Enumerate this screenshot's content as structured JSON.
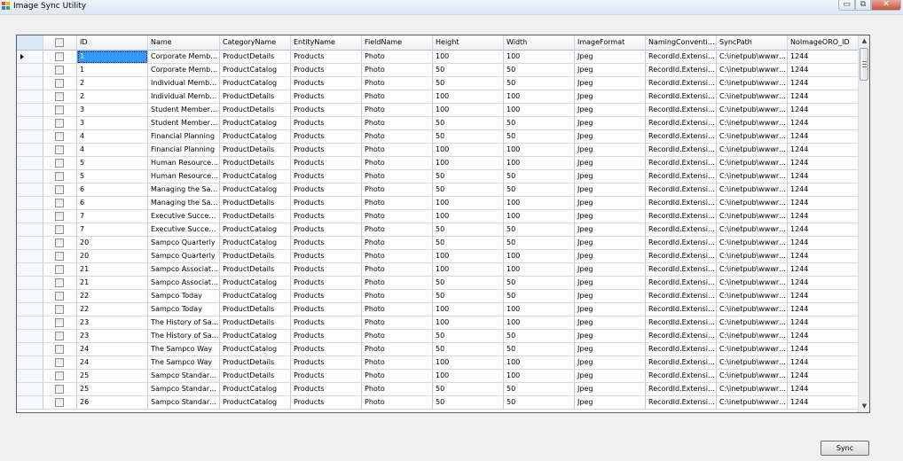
{
  "window": {
    "title": "Image Sync Utility",
    "minimize_glyph": "▭",
    "maximize_glyph": "⧉",
    "close_glyph": "✕"
  },
  "grid": {
    "columns": [
      "ID",
      "Name",
      "CategoryName",
      "EntityName",
      "FieldName",
      "Height",
      "Width",
      "ImageFormat",
      "NamingConvention",
      "SyncPath",
      "NoImageORO_ID"
    ],
    "rows": [
      {
        "id": "1",
        "name": "Corporate Member...",
        "category": "ProductDetails",
        "entity": "Products",
        "field": "Photo",
        "height": "100",
        "width": "100",
        "format": "Jpeg",
        "naming": "RecordId.Extension",
        "sync_path": "C:\\inetpub\\wwwro...",
        "no_image_id": "1244"
      },
      {
        "id": "1",
        "name": "Corporate Member...",
        "category": "ProductCatalog",
        "entity": "Products",
        "field": "Photo",
        "height": "50",
        "width": "50",
        "format": "Jpeg",
        "naming": "RecordId.Extension",
        "sync_path": "C:\\inetpub\\wwwro...",
        "no_image_id": "1244"
      },
      {
        "id": "2",
        "name": "Individual Member...",
        "category": "ProductCatalog",
        "entity": "Products",
        "field": "Photo",
        "height": "50",
        "width": "50",
        "format": "Jpeg",
        "naming": "RecordId.Extension",
        "sync_path": "C:\\inetpub\\wwwro...",
        "no_image_id": "1244"
      },
      {
        "id": "2",
        "name": "Individual Member...",
        "category": "ProductDetails",
        "entity": "Products",
        "field": "Photo",
        "height": "100",
        "width": "100",
        "format": "Jpeg",
        "naming": "RecordId.Extension",
        "sync_path": "C:\\inetpub\\wwwro...",
        "no_image_id": "1244"
      },
      {
        "id": "3",
        "name": "Student Membership",
        "category": "ProductDetails",
        "entity": "Products",
        "field": "Photo",
        "height": "100",
        "width": "100",
        "format": "Jpeg",
        "naming": "RecordId.Extension",
        "sync_path": "C:\\inetpub\\wwwro...",
        "no_image_id": "1244"
      },
      {
        "id": "3",
        "name": "Student Membership",
        "category": "ProductCatalog",
        "entity": "Products",
        "field": "Photo",
        "height": "50",
        "width": "50",
        "format": "Jpeg",
        "naming": "RecordId.Extension",
        "sync_path": "C:\\inetpub\\wwwro...",
        "no_image_id": "1244"
      },
      {
        "id": "4",
        "name": "Financial Planning",
        "category": "ProductCatalog",
        "entity": "Products",
        "field": "Photo",
        "height": "50",
        "width": "50",
        "format": "Jpeg",
        "naming": "RecordId.Extension",
        "sync_path": "C:\\inetpub\\wwwro...",
        "no_image_id": "1244"
      },
      {
        "id": "4",
        "name": "Financial Planning",
        "category": "ProductDetails",
        "entity": "Products",
        "field": "Photo",
        "height": "100",
        "width": "100",
        "format": "Jpeg",
        "naming": "RecordId.Extension",
        "sync_path": "C:\\inetpub\\wwwro...",
        "no_image_id": "1244"
      },
      {
        "id": "5",
        "name": "Human Resources...",
        "category": "ProductDetails",
        "entity": "Products",
        "field": "Photo",
        "height": "100",
        "width": "100",
        "format": "Jpeg",
        "naming": "RecordId.Extension",
        "sync_path": "C:\\inetpub\\wwwro...",
        "no_image_id": "1244"
      },
      {
        "id": "5",
        "name": "Human Resources...",
        "category": "ProductCatalog",
        "entity": "Products",
        "field": "Photo",
        "height": "50",
        "width": "50",
        "format": "Jpeg",
        "naming": "RecordId.Extension",
        "sync_path": "C:\\inetpub\\wwwro...",
        "no_image_id": "1244"
      },
      {
        "id": "6",
        "name": "Managing the Sam...",
        "category": "ProductCatalog",
        "entity": "Products",
        "field": "Photo",
        "height": "50",
        "width": "50",
        "format": "Jpeg",
        "naming": "RecordId.Extension",
        "sync_path": "C:\\inetpub\\wwwro...",
        "no_image_id": "1244"
      },
      {
        "id": "6",
        "name": "Managing the Sam...",
        "category": "ProductDetails",
        "entity": "Products",
        "field": "Photo",
        "height": "100",
        "width": "100",
        "format": "Jpeg",
        "naming": "RecordId.Extension",
        "sync_path": "C:\\inetpub\\wwwro...",
        "no_image_id": "1244"
      },
      {
        "id": "7",
        "name": "Executive Succes...",
        "category": "ProductDetails",
        "entity": "Products",
        "field": "Photo",
        "height": "100",
        "width": "100",
        "format": "Jpeg",
        "naming": "RecordId.Extension",
        "sync_path": "C:\\inetpub\\wwwro...",
        "no_image_id": "1244"
      },
      {
        "id": "7",
        "name": "Executive Succes...",
        "category": "ProductCatalog",
        "entity": "Products",
        "field": "Photo",
        "height": "50",
        "width": "50",
        "format": "Jpeg",
        "naming": "RecordId.Extension",
        "sync_path": "C:\\inetpub\\wwwro...",
        "no_image_id": "1244"
      },
      {
        "id": "20",
        "name": "Sampco Quarterly",
        "category": "ProductCatalog",
        "entity": "Products",
        "field": "Photo",
        "height": "50",
        "width": "50",
        "format": "Jpeg",
        "naming": "RecordId.Extension",
        "sync_path": "C:\\inetpub\\wwwro...",
        "no_image_id": "1244"
      },
      {
        "id": "20",
        "name": "Sampco Quarterly",
        "category": "ProductDetails",
        "entity": "Products",
        "field": "Photo",
        "height": "100",
        "width": "100",
        "format": "Jpeg",
        "naming": "RecordId.Extension",
        "sync_path": "C:\\inetpub\\wwwro...",
        "no_image_id": "1244"
      },
      {
        "id": "21",
        "name": "Sampco Associati...",
        "category": "ProductDetails",
        "entity": "Products",
        "field": "Photo",
        "height": "100",
        "width": "100",
        "format": "Jpeg",
        "naming": "RecordId.Extension",
        "sync_path": "C:\\inetpub\\wwwro...",
        "no_image_id": "1244"
      },
      {
        "id": "21",
        "name": "Sampco Associati...",
        "category": "ProductCatalog",
        "entity": "Products",
        "field": "Photo",
        "height": "50",
        "width": "50",
        "format": "Jpeg",
        "naming": "RecordId.Extension",
        "sync_path": "C:\\inetpub\\wwwro...",
        "no_image_id": "1244"
      },
      {
        "id": "22",
        "name": "Sampco Today",
        "category": "ProductCatalog",
        "entity": "Products",
        "field": "Photo",
        "height": "50",
        "width": "50",
        "format": "Jpeg",
        "naming": "RecordId.Extension",
        "sync_path": "C:\\inetpub\\wwwro...",
        "no_image_id": "1244"
      },
      {
        "id": "22",
        "name": "Sampco Today",
        "category": "ProductDetails",
        "entity": "Products",
        "field": "Photo",
        "height": "100",
        "width": "100",
        "format": "Jpeg",
        "naming": "RecordId.Extension",
        "sync_path": "C:\\inetpub\\wwwro...",
        "no_image_id": "1244"
      },
      {
        "id": "23",
        "name": "The History of Sa...",
        "category": "ProductDetails",
        "entity": "Products",
        "field": "Photo",
        "height": "100",
        "width": "100",
        "format": "Jpeg",
        "naming": "RecordId.Extension",
        "sync_path": "C:\\inetpub\\wwwro...",
        "no_image_id": "1244"
      },
      {
        "id": "23",
        "name": "The History of Sa...",
        "category": "ProductCatalog",
        "entity": "Products",
        "field": "Photo",
        "height": "50",
        "width": "50",
        "format": "Jpeg",
        "naming": "RecordId.Extension",
        "sync_path": "C:\\inetpub\\wwwro...",
        "no_image_id": "1244"
      },
      {
        "id": "24",
        "name": "The Sampco Way",
        "category": "ProductCatalog",
        "entity": "Products",
        "field": "Photo",
        "height": "50",
        "width": "50",
        "format": "Jpeg",
        "naming": "RecordId.Extension",
        "sync_path": "C:\\inetpub\\wwwro...",
        "no_image_id": "1244"
      },
      {
        "id": "24",
        "name": "The Sampco Way",
        "category": "ProductDetails",
        "entity": "Products",
        "field": "Photo",
        "height": "100",
        "width": "100",
        "format": "Jpeg",
        "naming": "RecordId.Extension",
        "sync_path": "C:\\inetpub\\wwwro...",
        "no_image_id": "1244"
      },
      {
        "id": "25",
        "name": "Sampco Standard...",
        "category": "ProductDetails",
        "entity": "Products",
        "field": "Photo",
        "height": "100",
        "width": "100",
        "format": "Jpeg",
        "naming": "RecordId.Extension",
        "sync_path": "C:\\inetpub\\wwwro...",
        "no_image_id": "1244"
      },
      {
        "id": "25",
        "name": "Sampco Standard...",
        "category": "ProductCatalog",
        "entity": "Products",
        "field": "Photo",
        "height": "50",
        "width": "50",
        "format": "Jpeg",
        "naming": "RecordId.Extension",
        "sync_path": "C:\\inetpub\\wwwro...",
        "no_image_id": "1244"
      },
      {
        "id": "26",
        "name": "Sampco Standard...",
        "category": "ProductCatalog",
        "entity": "Products",
        "field": "Photo",
        "height": "50",
        "width": "50",
        "format": "Jpeg",
        "naming": "RecordId.Extension",
        "sync_path": "C:\\inetpub\\wwwro...",
        "no_image_id": "1244"
      }
    ],
    "selected_row": 0,
    "selection_color": "#3399ff"
  },
  "scrollbar": {
    "up_glyph": "▲",
    "down_glyph": "▼"
  },
  "actions": {
    "sync_label": "Sync"
  }
}
